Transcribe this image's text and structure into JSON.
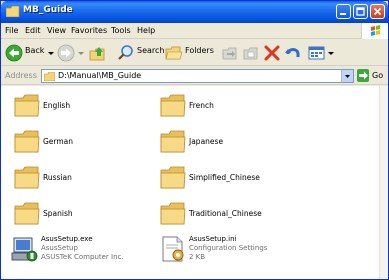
{
  "window": {
    "title": "MB_Guide"
  },
  "menu": [
    "File",
    "Edit",
    "View",
    "Favorites",
    "Tools",
    "Help"
  ],
  "toolbar": {
    "back_label": "Back",
    "search_label": "Search",
    "folders_label": "Folders"
  },
  "address": {
    "label": "Address",
    "path": "D:\\Manual\\MB_Guide",
    "go_label": "Go"
  },
  "folders": [
    "English",
    "French",
    "German",
    "Japanese",
    "Russian",
    "Simplified_Chinese",
    "Spanish",
    "Traditional_Chinese"
  ],
  "files": [
    {
      "name": "AsusSetup.exe",
      "line2": "AsusSetup",
      "line3": "ASUSTeK Computer Inc.",
      "icon": "setup-exe-icon"
    },
    {
      "name": "AsusSetup.ini",
      "line2": "Configuration Settings",
      "line3": "2 KB",
      "icon": "ini-settings-icon"
    }
  ],
  "colors": {
    "titlebar": "#0753DF",
    "folder": "#F5D37A",
    "close": "#C6401F"
  }
}
